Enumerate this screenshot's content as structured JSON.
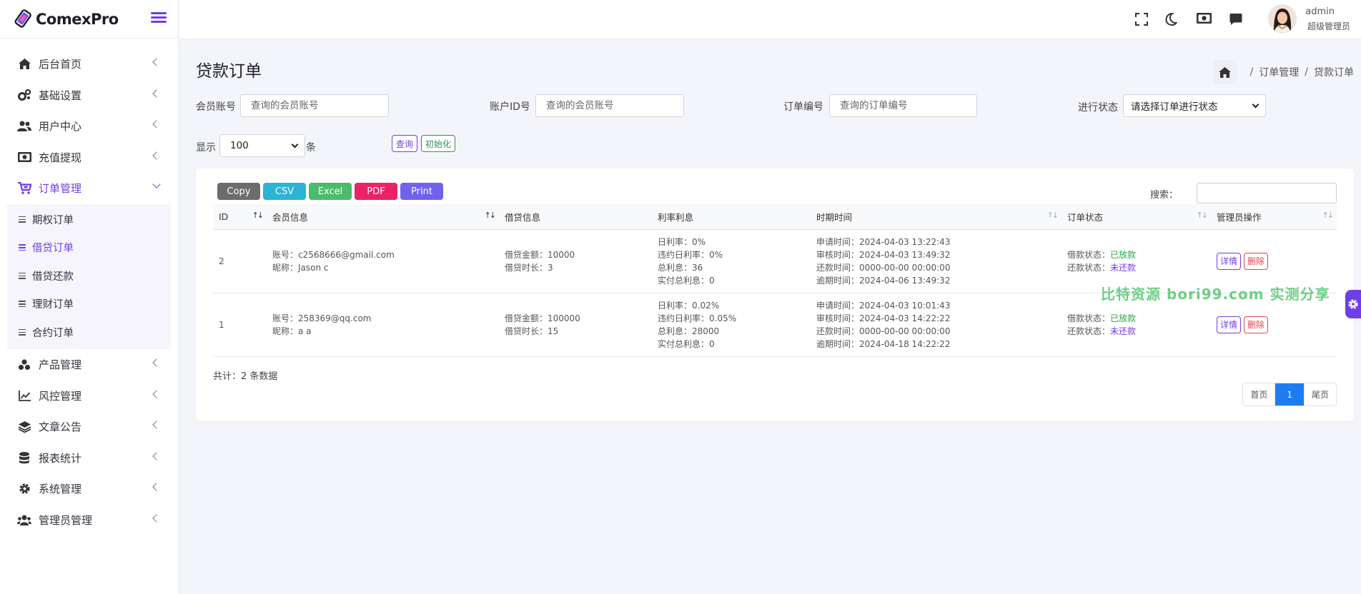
{
  "app": {
    "name": "ComexPro",
    "brand_color": "#6f3ee6"
  },
  "sidebar": {
    "items": [
      {
        "label": "后台首页",
        "icon": "home-icon"
      },
      {
        "label": "基础设置",
        "icon": "cogs-icon"
      },
      {
        "label": "用户中心",
        "icon": "users-icon"
      },
      {
        "label": "充值提现",
        "icon": "money-icon"
      },
      {
        "label": "订单管理",
        "icon": "cart-icon",
        "open": true
      },
      {
        "label": "产品管理",
        "icon": "cubes-icon"
      },
      {
        "label": "风控管理",
        "icon": "chart-line-icon"
      },
      {
        "label": "文章公告",
        "icon": "layers-icon"
      },
      {
        "label": "报表统计",
        "icon": "database-icon"
      },
      {
        "label": "系统管理",
        "icon": "gear-icon"
      },
      {
        "label": "管理员管理",
        "icon": "user-group-icon"
      }
    ],
    "order_submenu": [
      {
        "label": "期权订单"
      },
      {
        "label": "借贷订单",
        "active": true
      },
      {
        "label": "借贷还款"
      },
      {
        "label": "理财订单"
      },
      {
        "label": "合约订单"
      }
    ]
  },
  "topbar": {
    "user_name": "admin",
    "user_role": "超级管理员"
  },
  "page": {
    "title": "贷款订单",
    "breadcrumb": [
      "订单管理",
      "贷款订单"
    ]
  },
  "filters": {
    "member_label": "会员账号",
    "member_placeholder": "查询的会员账号",
    "account_label": "账户ID号",
    "account_placeholder": "查询的会员账号",
    "order_label": "订单编号",
    "order_placeholder": "查询的订单编号",
    "status_label": "进行状态",
    "status_value": "请选择订单进行状态",
    "show_label": "显示",
    "show_value": "100",
    "show_unit": "条",
    "query_button": "查询",
    "reset_button": "初始化"
  },
  "export": {
    "buttons": [
      {
        "label": "Copy",
        "color": "#6c6c6c"
      },
      {
        "label": "CSV",
        "color": "#2bb4d6"
      },
      {
        "label": "Excel",
        "color": "#4cbb6c"
      },
      {
        "label": "PDF",
        "color": "#ec2266"
      },
      {
        "label": "Print",
        "color": "#6f62ef"
      }
    ],
    "search_label": "搜索："
  },
  "table": {
    "headers": [
      "ID",
      "会员信息",
      "借贷信息",
      "利率利息",
      "时期时间",
      "订单状态",
      "管理员操作"
    ],
    "rows": [
      {
        "id": "2",
        "member": [
          "账号：c2568666@gmail.com",
          "昵称：Jason c"
        ],
        "loan": [
          "借贷金额：10000",
          "借贷时长：3"
        ],
        "rate": [
          "日利率：0%",
          "违约日利率：0%",
          "总利息：36",
          "实付总利息：0"
        ],
        "time": [
          "申请时间：2024-04-03 13:22:43",
          "审核时间：2024-04-03 13:49:32",
          "还款时间：0000-00-00 00:00:00",
          "逾期时间：2024-04-06 13:49:32"
        ],
        "loan_status_label": "借款状态：",
        "loan_status": "已放款",
        "repay_status_label": "还款状态：",
        "repay_status": "未还款",
        "detail": "详情",
        "delete": "删除"
      },
      {
        "id": "1",
        "member": [
          "账号：258369@qq.com",
          "昵称：a a"
        ],
        "loan": [
          "借贷金额：100000",
          "借贷时长：15"
        ],
        "rate": [
          "日利率：0.02%",
          "违约日利率：0.05%",
          "总利息：28000",
          "实付总利息：0"
        ],
        "time": [
          "申请时间：2024-04-03 10:01:43",
          "审核时间：2024-04-03 14:22:22",
          "还款时间：0000-00-00 00:00:00",
          "逾期时间：2024-04-18 14:22:22"
        ],
        "loan_status_label": "借款状态：",
        "loan_status": "已放款",
        "repay_status_label": "还款状态：",
        "repay_status": "未还款",
        "detail": "详情",
        "delete": "删除"
      }
    ],
    "total": "共计：2 条数据"
  },
  "pager": {
    "first": "首页",
    "current": "1",
    "last": "尾页"
  },
  "watermark": "比特资源 bori99.com 实测分享"
}
